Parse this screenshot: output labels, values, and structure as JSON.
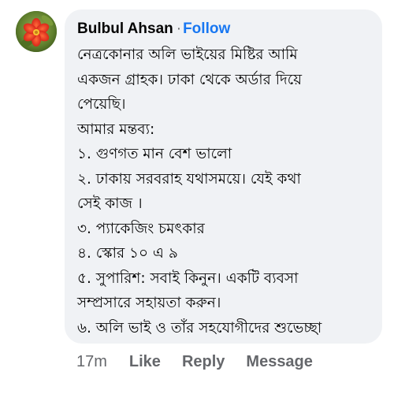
{
  "comment": {
    "author": "Bulbul Ahsan",
    "separator": "·",
    "follow_label": "Follow",
    "text_lines": [
      "নেত্রকোনার অলি ভাইয়ের মিষ্টির আমি",
      "একজন গ্রাহক। ঢাকা থেকে অর্ডার দিয়ে",
      "পেয়েছি।",
      "আমার মন্তব্য:",
      "১. গুণগত মান বেশ ভালো",
      "২. ঢাকায় সরবরাহ যথাসময়ে। যেই কথা",
      "সেই কাজ ।",
      "৩. প্যাকেজিং চমৎকার",
      "৪. স্কোর ১০ এ ৯",
      "৫. সুপারিশ: সবাই কিনুন। একটি ব্যবসা",
      "সম্প্রসারে সহায়তা করুন।",
      "৬. অলি ভাই ও তাঁর সহযোগীদের শুভেচ্ছা"
    ]
  },
  "actions": {
    "time": "17m",
    "like_label": "Like",
    "reply_label": "Reply",
    "message_label": "Message"
  },
  "colors": {
    "bubble_bg": "#f0f2f5",
    "link_blue": "#1877f2",
    "meta_gray": "#65676b"
  },
  "icons": {
    "avatar": "red-flower-avatar"
  }
}
